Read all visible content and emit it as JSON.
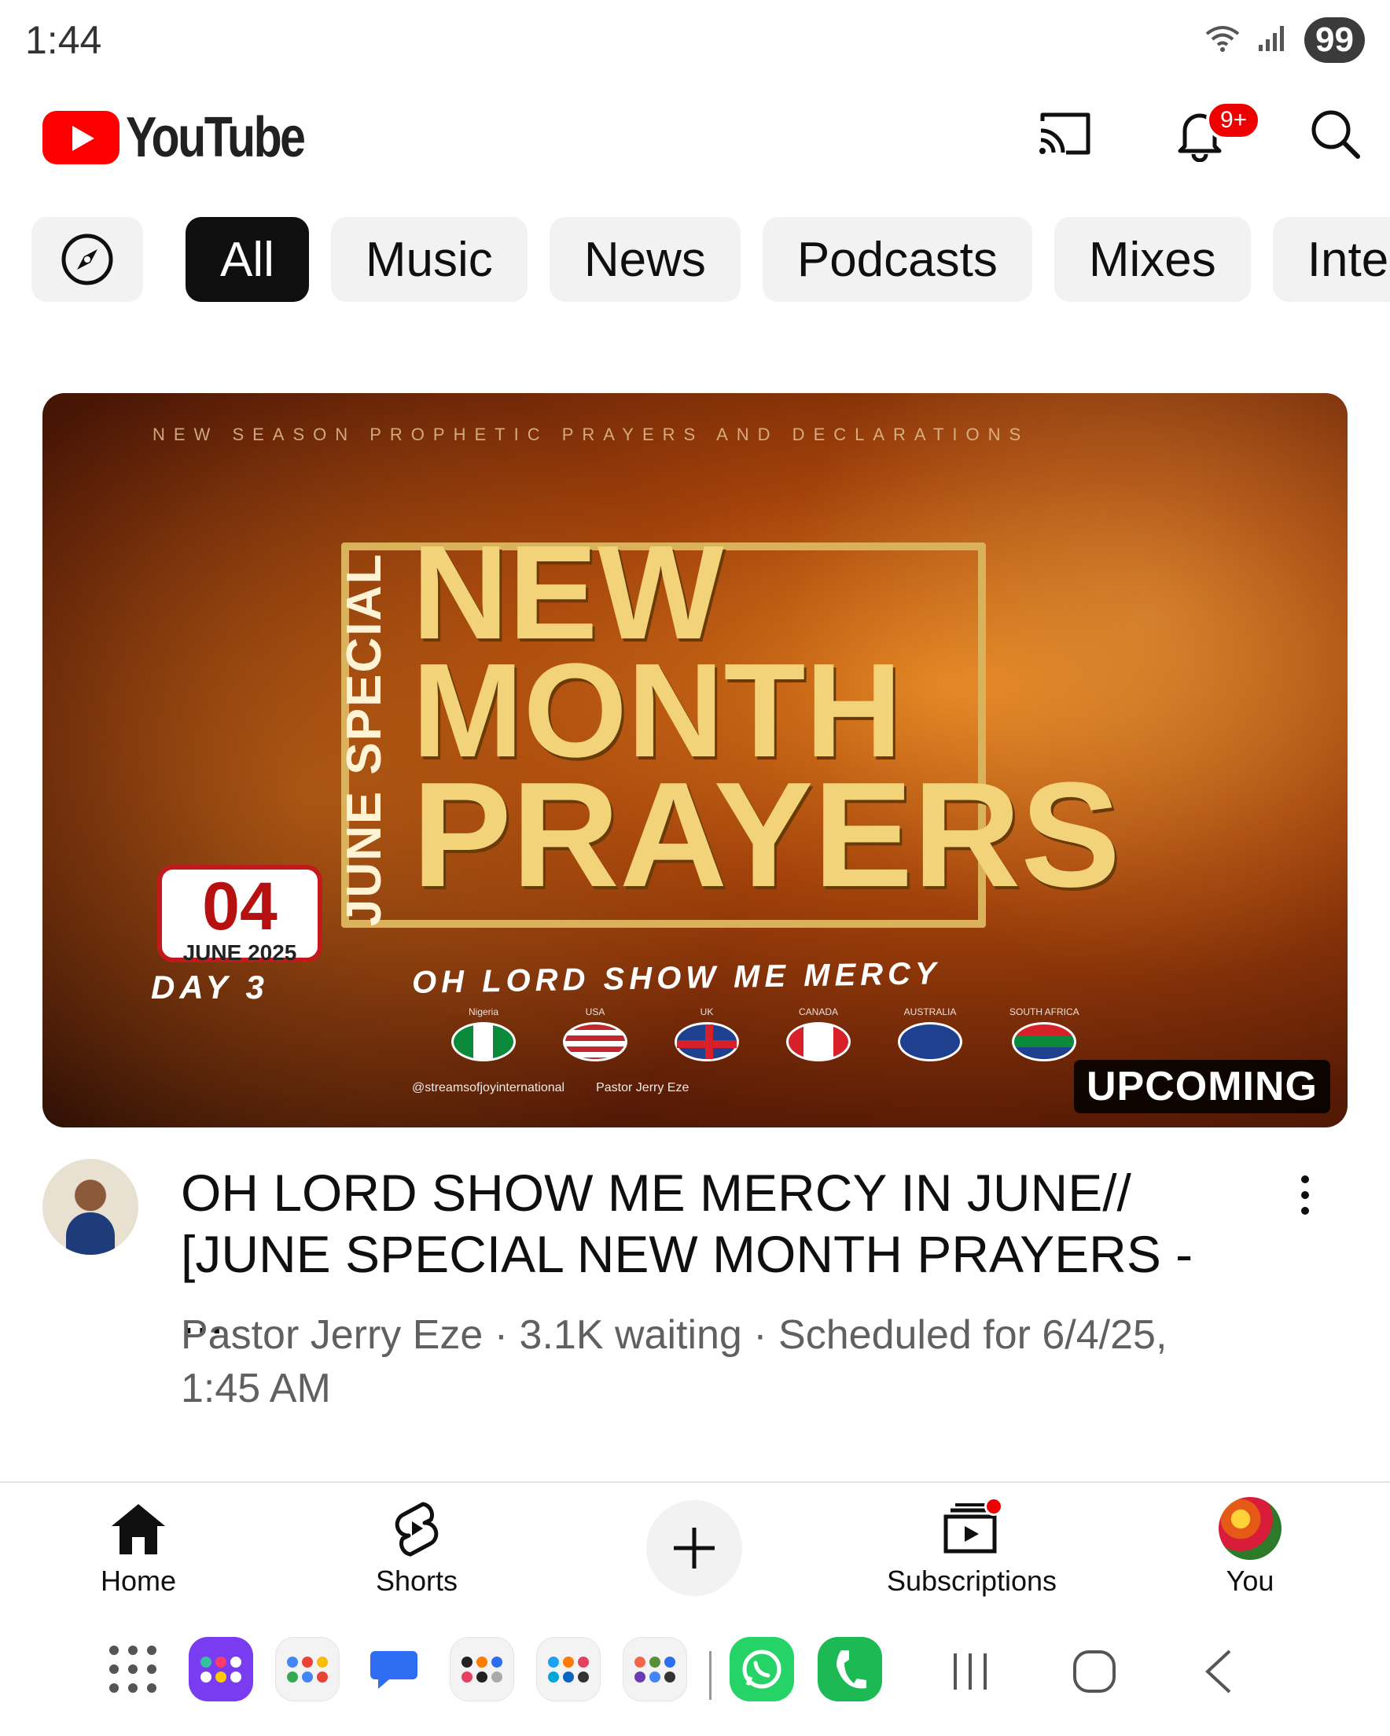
{
  "status_bar": {
    "time": "1:44",
    "battery": "99"
  },
  "header": {
    "app_name": "YouTube",
    "notification_badge": "9+"
  },
  "chips": [
    {
      "label": "All",
      "active": true
    },
    {
      "label": "Music",
      "active": false
    },
    {
      "label": "News",
      "active": false
    },
    {
      "label": "Podcasts",
      "active": false
    },
    {
      "label": "Mixes",
      "active": false
    },
    {
      "label": "Inter",
      "active": false
    }
  ],
  "video": {
    "thumbnail": {
      "top_banner": "NEW SEASON PROPHETIC PRAYERS AND DECLARATIONS",
      "vertical_text": "JUNE SPECIAL",
      "title_line1": "NEW",
      "title_line2": "MONTH",
      "title_line3": "PRAYERS",
      "date_number": "04",
      "date_month": "JUNE 2025",
      "day": "DAY 3",
      "subtitle": "OH LORD SHOW ME MERCY",
      "flags": [
        {
          "name": "Nigeria"
        },
        {
          "name": "USA"
        },
        {
          "name": "UK"
        },
        {
          "name": "CANADA"
        },
        {
          "name": "AUSTRALIA"
        },
        {
          "name": "SOUTH AFRICA"
        }
      ],
      "footer_handle": "@streamsofjoyinternational",
      "footer_name": "Pastor Jerry Eze",
      "badge": "UPCOMING"
    },
    "title": "OH LORD SHOW ME MERCY IN JUNE// [JUNE SPECIAL NEW MONTH PRAYERS - ...",
    "subtitle": "Pastor Jerry Eze · 3.1K waiting · Scheduled for 6/4/25, 1:45 AM"
  },
  "bottom_nav": {
    "home": "Home",
    "shorts": "Shorts",
    "subscriptions": "Subscriptions",
    "you": "You"
  },
  "colors": {
    "brand_red": "#ff0000",
    "chip_bg": "#f2f2f2",
    "active_chip": "#0f0f0f",
    "meta_gray": "#606060"
  }
}
